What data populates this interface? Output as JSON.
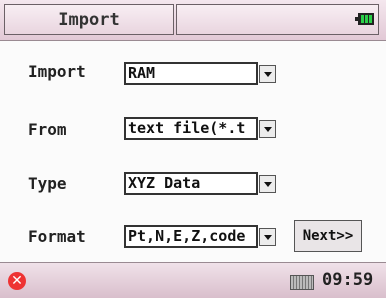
{
  "titlebar": {
    "tab_label": "Import"
  },
  "form": {
    "import": {
      "label": "Import",
      "value": "RAM"
    },
    "from": {
      "label": "From",
      "value": "text file(*.t"
    },
    "type": {
      "label": "Type",
      "value": "XYZ Data"
    },
    "format": {
      "label": "Format",
      "value": "Pt,N,E,Z,code"
    },
    "next_label": "Next>>"
  },
  "statusbar": {
    "time": "09:59"
  },
  "icons": {
    "battery": "battery-icon",
    "close": "close-icon",
    "keyboard": "keyboard-icon"
  },
  "colors": {
    "titlebar": "#e2c9d6",
    "battery_fill": "#2cd04a",
    "close": "#e33333"
  }
}
